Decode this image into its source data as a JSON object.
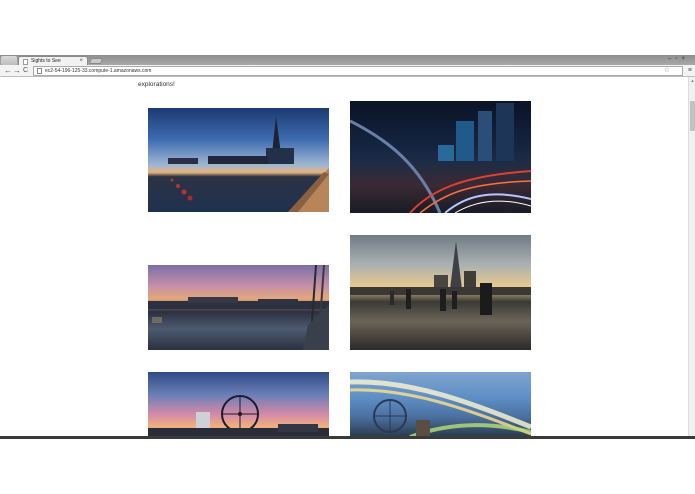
{
  "browser": {
    "tab_title": "Sights to See",
    "tab_close": "×",
    "url": "ec2-54-196-125-33.compute-1.amazonaws.com",
    "back_icon": "←",
    "forward_icon": "→",
    "reload_icon": "C",
    "star_icon": "☆",
    "menu_icon": "≡",
    "window_controls": "–▫×"
  },
  "page": {
    "intro_visible": "explorations!"
  },
  "photos": [
    {
      "subject": "shard-thames-dusk"
    },
    {
      "subject": "city-highway-night"
    },
    {
      "subject": "thames-river-sunset"
    },
    {
      "subject": "shard-riverside-pier"
    },
    {
      "subject": "london-eye-sunset"
    },
    {
      "subject": "london-eye-light-trails"
    }
  ],
  "scrollbar": {
    "up_arrow": "▲"
  }
}
